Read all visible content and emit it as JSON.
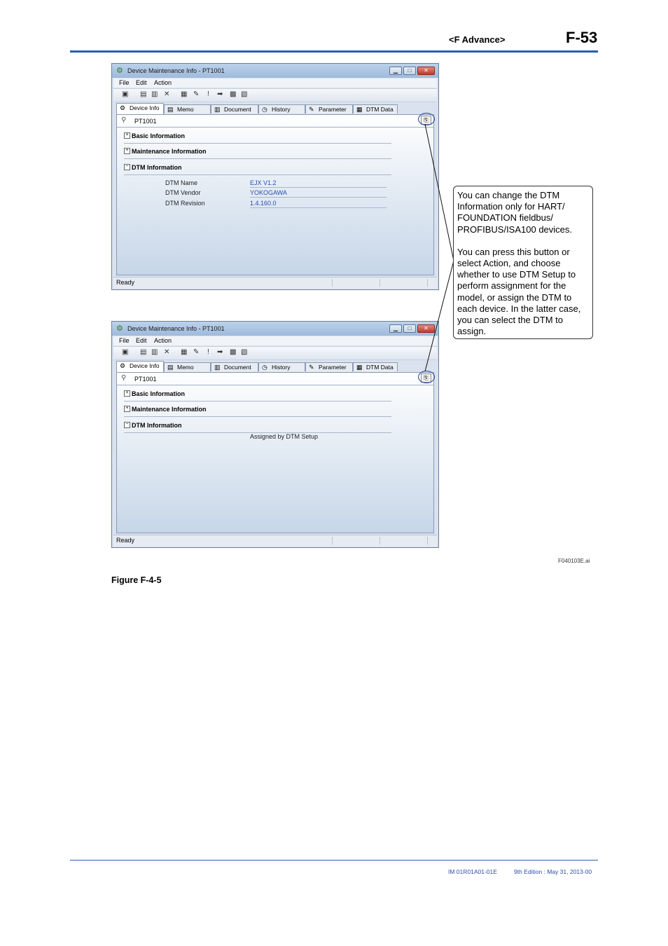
{
  "header": {
    "section": "<F  Advance>",
    "page": "F-53"
  },
  "window": {
    "title": "Device Maintenance Info - PT1001",
    "menu": [
      "File",
      "Edit",
      "Action"
    ],
    "tabs": [
      "Device Info",
      "Memo",
      "Document",
      "History",
      "Parameter",
      "DTM Data"
    ],
    "device": "PT1001",
    "sections": [
      "Basic Information",
      "Maintenance Information",
      "DTM Information"
    ],
    "status": "Ready",
    "dtm_button_glyph": "⎘",
    "min_glyph": "▁",
    "max_glyph": "□",
    "close_glyph": "✕"
  },
  "screen1": {
    "fields": [
      {
        "label": "DTM Name",
        "value": "EJX V1.2"
      },
      {
        "label": "DTM Vendor",
        "value": "YOKOGAWA"
      },
      {
        "label": "DTM Revision",
        "value": "1.4.160.0"
      }
    ]
  },
  "screen2": {
    "assigned_text": "Assigned by DTM Setup"
  },
  "callout": {
    "paragraph1": "You can change the DTM Information only for HART/ FOUNDATION fieldbus/ PROFIBUS/ISA100 devices.",
    "paragraph2": "You can press this button or select Action, and choose whether to use DTM Setup to perform assignment for the model, or assign the DTM to each device. In the latter case, you can select the DTM to assign."
  },
  "figure": {
    "file": "F040103E.ai",
    "caption": "Figure F-4-5"
  },
  "footer": {
    "doc": "IM 01R01A01-01E",
    "edition": "9th Edition : May 31, 2013-00"
  },
  "colors": {
    "accent": "#2a5db0",
    "value_text": "#2a4db0",
    "highlight_ring": "#2344a0"
  }
}
